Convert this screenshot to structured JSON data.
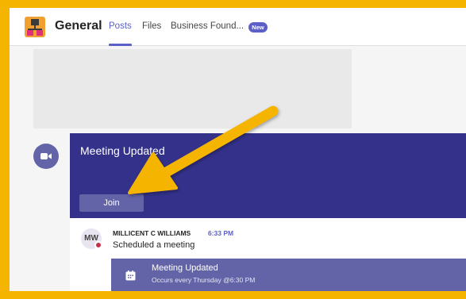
{
  "header": {
    "channel_name": "General",
    "tabs": [
      {
        "label": "Posts",
        "active": true
      },
      {
        "label": "Files",
        "active": false
      },
      {
        "label": "Business Found..."
      }
    ],
    "new_badge": "New"
  },
  "meeting_card": {
    "title": "Meeting Updated",
    "join_label": "Join"
  },
  "message": {
    "avatar_initials": "MW",
    "author": "MILLICENT C WILLIAMS",
    "time": "6:33 PM",
    "text": "Scheduled a meeting",
    "meeting": {
      "title": "Meeting Updated",
      "recurrence": "Occurs every Thursday @6:30 PM"
    }
  },
  "colors": {
    "accent": "#5b5fc7",
    "banner": "#33318a",
    "button": "#6264a7",
    "highlight_arrow": "#f5b400",
    "frame": "#f5b400"
  }
}
